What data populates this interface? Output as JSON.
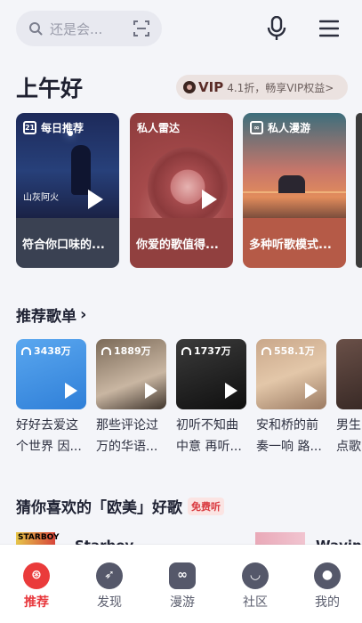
{
  "search": {
    "placeholder": "还是会..."
  },
  "greeting": "上午好",
  "vip": {
    "badge": "VIP",
    "promo": "4.1折，畅享VIP权益>"
  },
  "cards": [
    {
      "tag": "每日推荐",
      "caption": "符合你口味的...",
      "art_text": "山灰阿火"
    },
    {
      "tag": "私人雷达",
      "caption": "你爱的歌值得..."
    },
    {
      "tag": "私人漫游",
      "caption": "多种听歌模式..."
    }
  ],
  "section_playlists": {
    "title": "推荐歌单",
    "chevron": "›"
  },
  "playlists": [
    {
      "count": "3438万",
      "name": "好好去爱这个世界 因..."
    },
    {
      "count": "1889万",
      "name": "那些评论过万的华语..."
    },
    {
      "count": "1737万",
      "name": "初听不知曲中意 再听..."
    },
    {
      "count": "558.1万",
      "name": "安和桥的前奏一响 路..."
    },
    {
      "count": "",
      "name": "男生点歌"
    }
  ],
  "section_guess": {
    "title": "猜你喜欢的「欧美」好歌",
    "badge": "免费听"
  },
  "songs": [
    {
      "title": "Starboy",
      "cover_text": "STARBOY"
    },
    {
      "title": "Waving"
    }
  ],
  "nav": [
    {
      "label": "推荐",
      "icon": "recommend-icon",
      "active": true
    },
    {
      "label": "发现",
      "icon": "discover-icon",
      "active": false
    },
    {
      "label": "漫游",
      "icon": "roam-icon",
      "active": false
    },
    {
      "label": "社区",
      "icon": "community-icon",
      "active": false
    },
    {
      "label": "我的",
      "icon": "profile-icon",
      "active": false
    }
  ],
  "colors": {
    "accent": "#ea3b3b",
    "background": "#f4f5f9"
  }
}
